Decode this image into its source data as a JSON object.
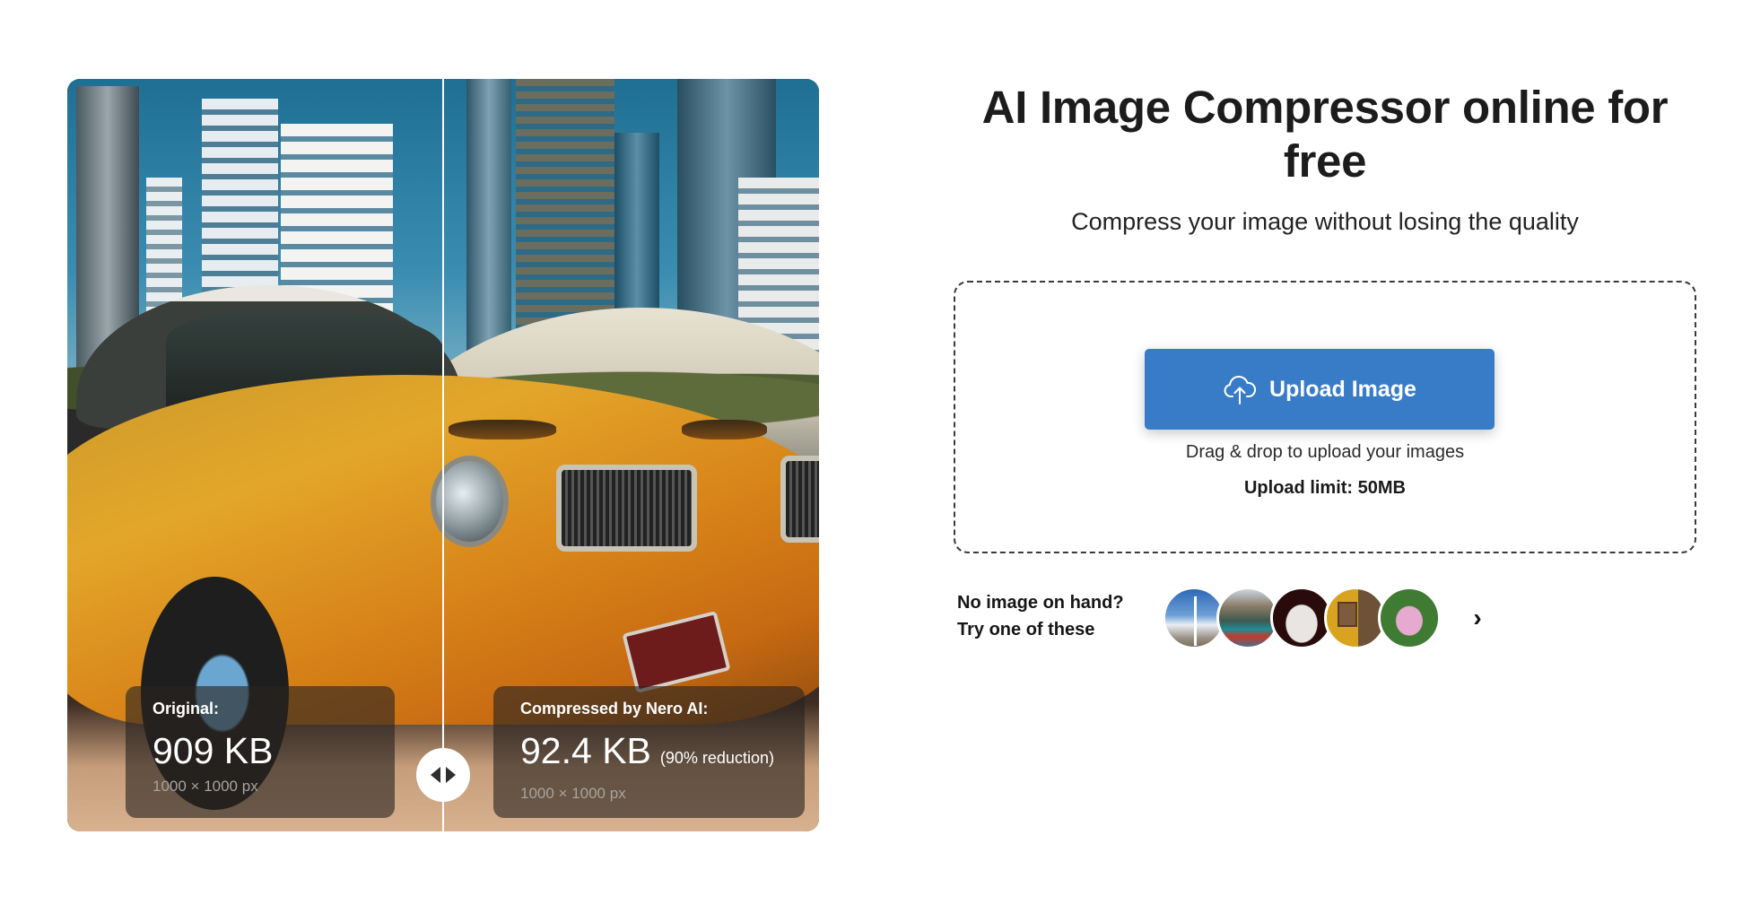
{
  "compare": {
    "original": {
      "label": "Original:",
      "size": "909 KB",
      "dimensions": "1000 × 1000 px"
    },
    "compressed": {
      "label": "Compressed by Nero AI:",
      "size": "92.4 KB",
      "reduction": "(90% reduction)",
      "dimensions": "1000 × 1000 px"
    },
    "handle_icon": "left-right-arrows-icon"
  },
  "hero": {
    "title": "AI Image Compressor online for free",
    "subtitle": "Compress your image without losing the quality"
  },
  "upload": {
    "button_label": "Upload Image",
    "button_icon": "cloud-upload-icon",
    "drag_text": "Drag & drop to upload your images",
    "limit_text": "Upload limit: 50MB",
    "accent_color": "#387cc8"
  },
  "samples": {
    "prompt_line1": "No image on hand?",
    "prompt_line2": "Try one of these",
    "thumbnails": [
      {
        "name": "wind-turbines"
      },
      {
        "name": "mountain-lake"
      },
      {
        "name": "white-kitten"
      },
      {
        "name": "yellow-wall-window"
      },
      {
        "name": "pink-lotus"
      }
    ],
    "next_icon": "›"
  }
}
